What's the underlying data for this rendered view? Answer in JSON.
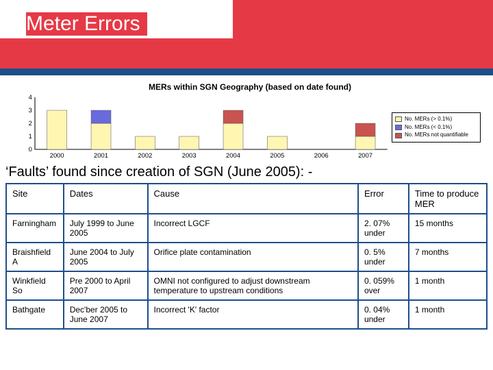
{
  "title": "Meter Errors",
  "chart_data": {
    "type": "bar",
    "title": "MERs within SGN Geography (based on date found)",
    "categories": [
      "2000",
      "2001",
      "2002",
      "2003",
      "2004",
      "2005",
      "2006",
      "2007"
    ],
    "ylim": [
      0,
      4
    ],
    "yticks": [
      0,
      1,
      2,
      3,
      4
    ],
    "series": [
      {
        "name": "No. MERs (> 0.1%)",
        "color": "#fff6b2",
        "values": [
          3,
          2,
          1,
          1,
          2,
          1,
          0,
          1
        ]
      },
      {
        "name": "No. MERs (< 0.1%)",
        "color": "#6a6adf",
        "values": [
          0,
          1,
          0,
          0,
          0,
          0,
          0,
          0
        ]
      },
      {
        "name": "No. MERs not quantifiable",
        "color": "#c9534f",
        "values": [
          0,
          0,
          0,
          0,
          1,
          0,
          0,
          1
        ]
      }
    ]
  },
  "legend": [
    {
      "label": "No. MERs (> 0.1%)",
      "color": "#fff6b2"
    },
    {
      "label": "No. MERs (< 0.1%)",
      "color": "#6a6adf"
    },
    {
      "label": "No. MERs not quantifiable",
      "color": "#c9534f"
    }
  ],
  "sub_heading": "‘Faults’ found since creation of SGN (June 2005): -",
  "table": {
    "headers": [
      "Site",
      "Dates",
      "Cause",
      "Error",
      "Time to produce MER"
    ],
    "rows": [
      {
        "site": "Farningham",
        "dates": "July 1999 to June 2005",
        "cause": "Incorrect LGCF",
        "error": "2. 07% under",
        "time": "15 months"
      },
      {
        "site": "Braishfield A",
        "dates": "June 2004 to July 2005",
        "cause": "Orifice plate contamination",
        "error": "0. 5% under",
        "time": "7 months"
      },
      {
        "site": "Winkfield So",
        "dates": "Pre 2000 to April 2007",
        "cause": "OMNI not configured to adjust downstream temperature to upstream conditions",
        "error": "0. 059% over",
        "time": "1 month"
      },
      {
        "site": "Bathgate",
        "dates": "Dec'ber 2005 to June 2007",
        "cause": "Incorrect 'K' factor",
        "error": "0. 04% under",
        "time": "1 month"
      }
    ]
  }
}
